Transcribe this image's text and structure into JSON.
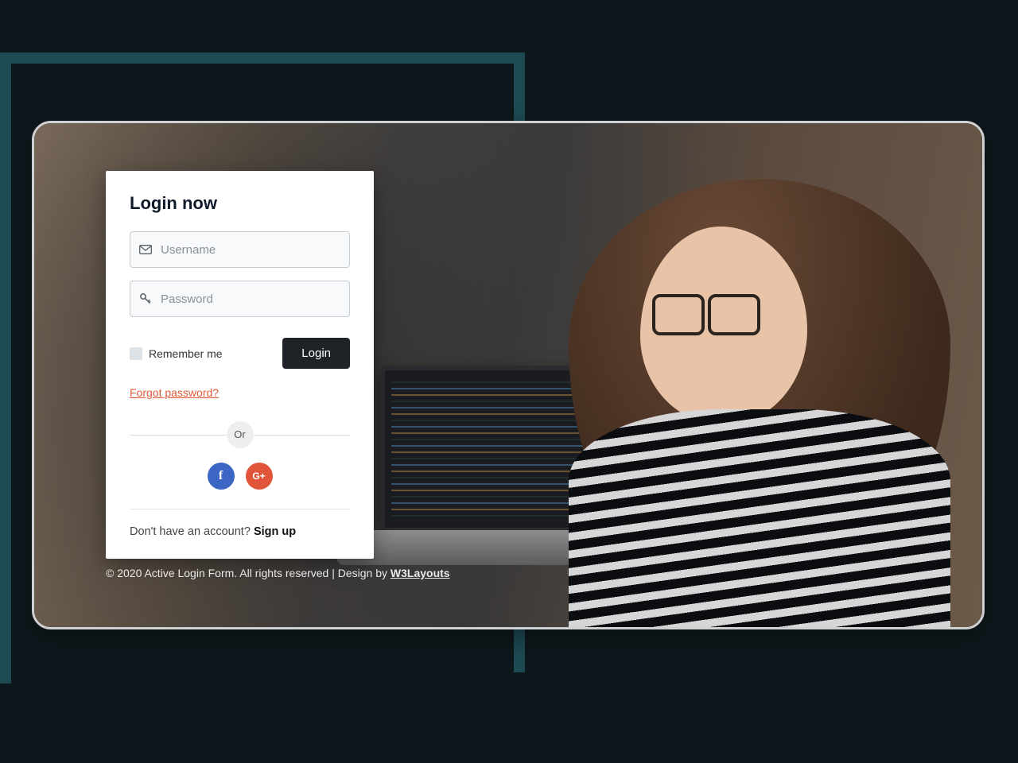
{
  "login": {
    "title": "Login now",
    "username_placeholder": "Username",
    "password_placeholder": "Password",
    "remember_label": "Remember me",
    "submit_label": "Login",
    "forgot_label": "Forgot password?",
    "divider_label": "Or",
    "signup_prompt": "Don't have an account? ",
    "signup_link": "Sign up"
  },
  "social": {
    "facebook": "f",
    "google": "G+"
  },
  "footer": {
    "text": "© 2020 Active Login Form. All rights reserved | Design by ",
    "link": "W3Layouts"
  },
  "icons": {
    "envelope": "envelope-icon",
    "key": "key-icon"
  }
}
